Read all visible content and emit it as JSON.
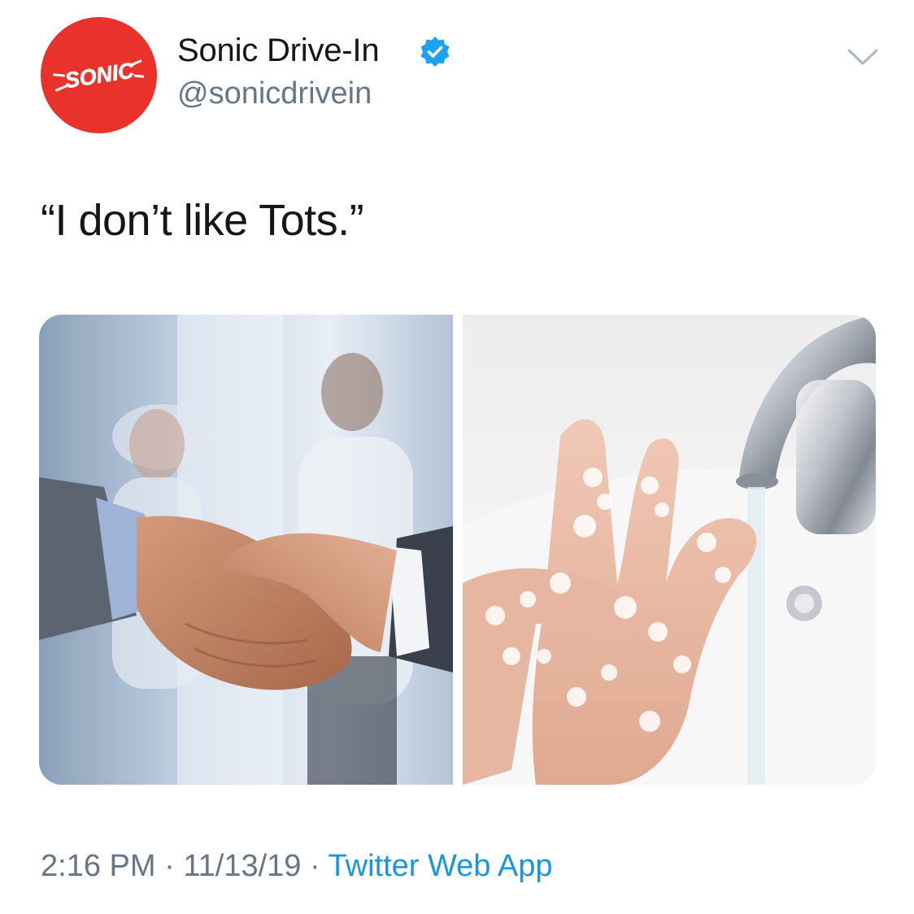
{
  "tweet": {
    "author": {
      "display_name": "Sonic Drive-In",
      "handle": "@sonicdrivein",
      "avatar_logo_text": "SONIC",
      "verified": true
    },
    "text": "“I don’t like Tots.”",
    "media": [
      {
        "alt": "handshake-photo"
      },
      {
        "alt": "hand-washing-photo"
      }
    ],
    "time": "2:16 PM",
    "separator": "·",
    "date": "11/13/19",
    "source": "Twitter Web App"
  },
  "colors": {
    "brand_red": "#e8322b",
    "verified_blue": "#1da1f2",
    "link_blue": "#1b95e0",
    "secondary_text": "#657786"
  }
}
